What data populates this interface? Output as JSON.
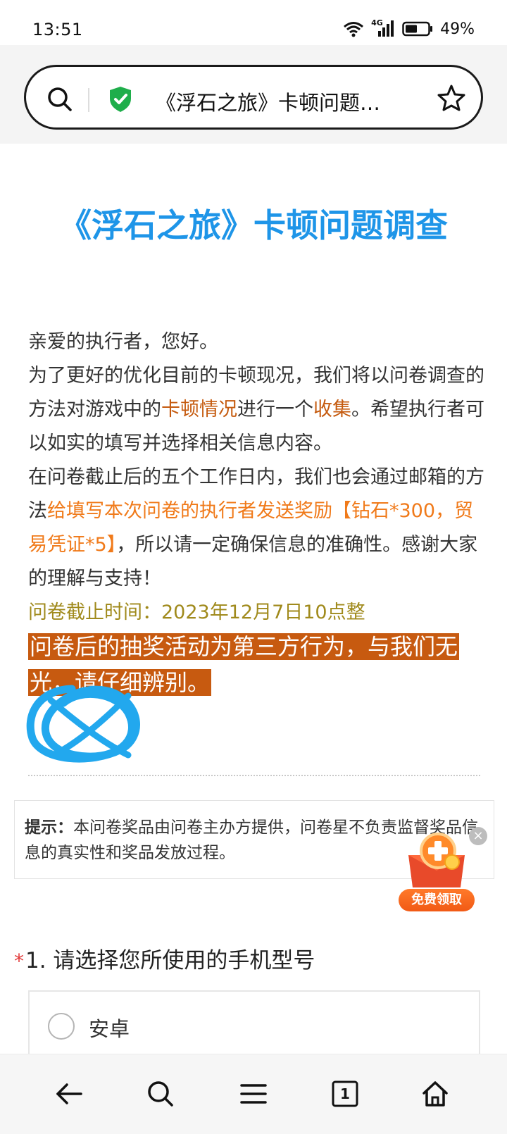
{
  "status_bar": {
    "time": "13:51",
    "network": "4G",
    "battery": "49%"
  },
  "browser": {
    "url_title": "《浮石之旅》卡顿问题…",
    "icons": [
      "search-icon",
      "shield-icon",
      "star-icon"
    ]
  },
  "survey": {
    "title": "《浮石之旅》卡顿问题调查",
    "intro": {
      "p1": "亲爱的执行者，您好。",
      "p2_a": "为了更好的优化目前的卡顿现况，我们将以问卷调查的方法对游戏中的",
      "p2_hl1": "卡顿情况",
      "p2_b": "进行一个",
      "p2_hl2": "收集",
      "p2_c": "。希望执行者可以如实的填写并选择相关信息内容。",
      "p3_a": "在问卷截止后的五个工作日内，我们也会通过邮箱的方法",
      "p3_hl": "给填写本次问卷的执行者发送奖励【钻石*300，贸易凭证*5】",
      "p3_b": "，所以请一定确保信息的准确性。感谢大家的理解与支持！",
      "deadline": "问卷截止时间：2023年12月7日10点整",
      "banner": "问卷后的抽奖活动为第三方行为，与我们无光，请仔细辨别。"
    },
    "tip": {
      "label": "提示：",
      "text": "本问卷奖品由问卷主办方提供，问卷星不负责监督奖品信息的真实性和奖品发放过程。"
    },
    "promo": {
      "label": "免费领取",
      "close": "×"
    },
    "question": {
      "required_mark": "*",
      "text": "1. 请选择您所使用的手机型号",
      "options": [
        "安卓"
      ]
    }
  },
  "colors": {
    "title": "#1e95e8",
    "highlight": "#c55a0e",
    "banner_bg": "#c75a10",
    "deadline": "#a08a1c",
    "shield": "#1fae4b",
    "scribble": "#22a8ee"
  },
  "bottom_nav": [
    "back-arrow-icon",
    "search-icon",
    "menu-icon",
    "tabs-icon",
    "home-icon"
  ],
  "tabs_count": "1"
}
